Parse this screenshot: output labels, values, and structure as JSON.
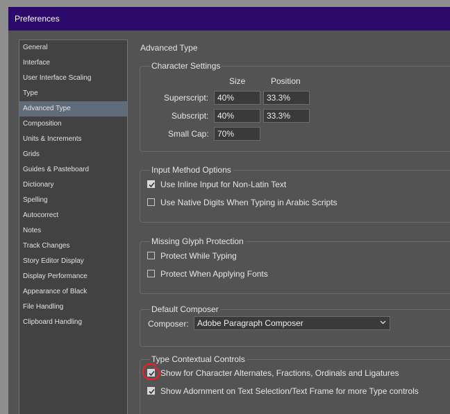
{
  "window": {
    "title": "Preferences"
  },
  "sidebar": {
    "items": [
      {
        "label": "General"
      },
      {
        "label": "Interface"
      },
      {
        "label": "User Interface Scaling"
      },
      {
        "label": "Type"
      },
      {
        "label": "Advanced Type",
        "selected": true
      },
      {
        "label": "Composition"
      },
      {
        "label": "Units & Increments"
      },
      {
        "label": "Grids"
      },
      {
        "label": "Guides & Pasteboard"
      },
      {
        "label": "Dictionary"
      },
      {
        "label": "Spelling"
      },
      {
        "label": "Autocorrect"
      },
      {
        "label": "Notes"
      },
      {
        "label": "Track Changes"
      },
      {
        "label": "Story Editor Display"
      },
      {
        "label": "Display Performance"
      },
      {
        "label": "Appearance of Black"
      },
      {
        "label": "File Handling"
      },
      {
        "label": "Clipboard Handling"
      }
    ]
  },
  "main": {
    "heading": "Advanced Type",
    "character_settings": {
      "label": "Character Settings",
      "col_size": "Size",
      "col_position": "Position",
      "superscript": {
        "label": "Superscript:",
        "size": "40%",
        "position": "33.3%"
      },
      "subscript": {
        "label": "Subscript:",
        "size": "40%",
        "position": "33.3%"
      },
      "small_cap": {
        "label": "Small Cap:",
        "size": "70%"
      }
    },
    "input_method": {
      "label": "Input Method Options",
      "inline_input": {
        "label": "Use Inline Input for Non-Latin Text",
        "checked": true
      },
      "native_digits": {
        "label": "Use Native Digits When Typing in Arabic Scripts",
        "checked": false
      }
    },
    "missing_glyph": {
      "label": "Missing Glyph Protection",
      "protect_typing": {
        "label": "Protect While Typing",
        "checked": false
      },
      "protect_fonts": {
        "label": "Protect When Applying Fonts",
        "checked": false
      }
    },
    "default_composer": {
      "label": "Default Composer",
      "composer_label": "Composer:",
      "composer_value": "Adobe Paragraph Composer"
    },
    "type_contextual": {
      "label": "Type Contextual Controls",
      "show_alternates": {
        "label": "Show for Character Alternates, Fractions, Ordinals and Ligatures",
        "checked": true
      },
      "show_adornment": {
        "label": "Show Adornment on Text Selection/Text Frame for more Type controls",
        "checked": true
      }
    }
  },
  "colors": {
    "titlebar": "#2b0a6b",
    "panel": "#535353",
    "selection": "#5f6b78",
    "annotation": "#e8202a"
  }
}
